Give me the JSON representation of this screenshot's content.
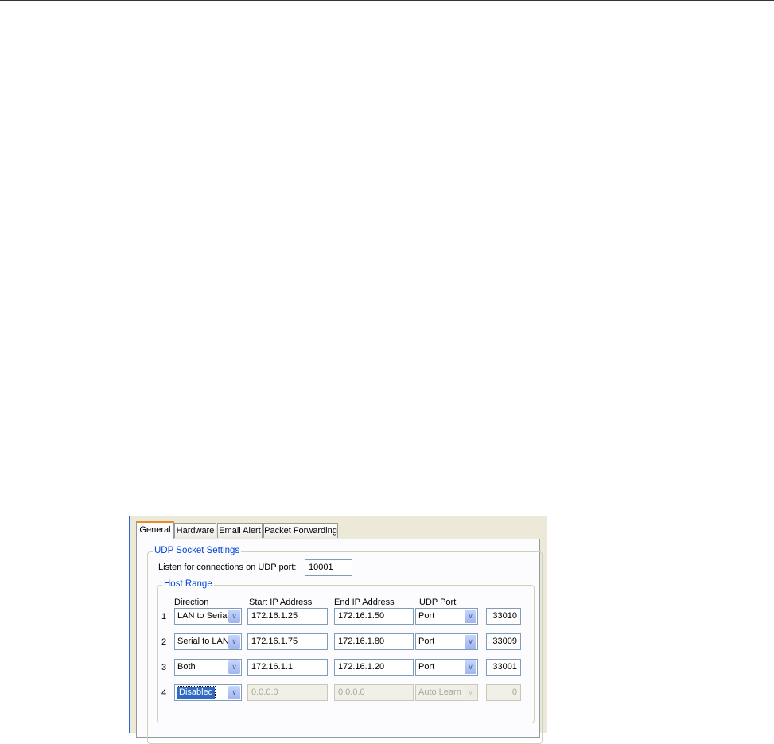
{
  "tabs": [
    "General",
    "Hardware",
    "Email Alert",
    "Packet Forwarding"
  ],
  "udp_group": "UDP Socket Settings",
  "listen_label": "Listen for connections on UDP port:",
  "listen_port": "10001",
  "host_group": "Host Range",
  "headers": {
    "direction": "Direction",
    "start": "Start IP Address",
    "end": "End IP Address",
    "udp_port": "UDP Port"
  },
  "rows": [
    {
      "n": "1",
      "direction": "LAN to Serial",
      "start": "172.16.1.25",
      "end": "172.16.1.50",
      "port_mode": "Port",
      "port": "33010"
    },
    {
      "n": "2",
      "direction": "Serial to LAN",
      "start": "172.16.1.75",
      "end": "172.16.1.80",
      "port_mode": "Port",
      "port": "33009"
    },
    {
      "n": "3",
      "direction": "Both",
      "start": "172.16.1.1",
      "end": "172.16.1.20",
      "port_mode": "Port",
      "port": "33001"
    },
    {
      "n": "4",
      "direction": "Disabled",
      "start": "0.0.0.0",
      "end": "0.0.0.0",
      "port_mode": "Auto Learn",
      "port": "0"
    }
  ]
}
